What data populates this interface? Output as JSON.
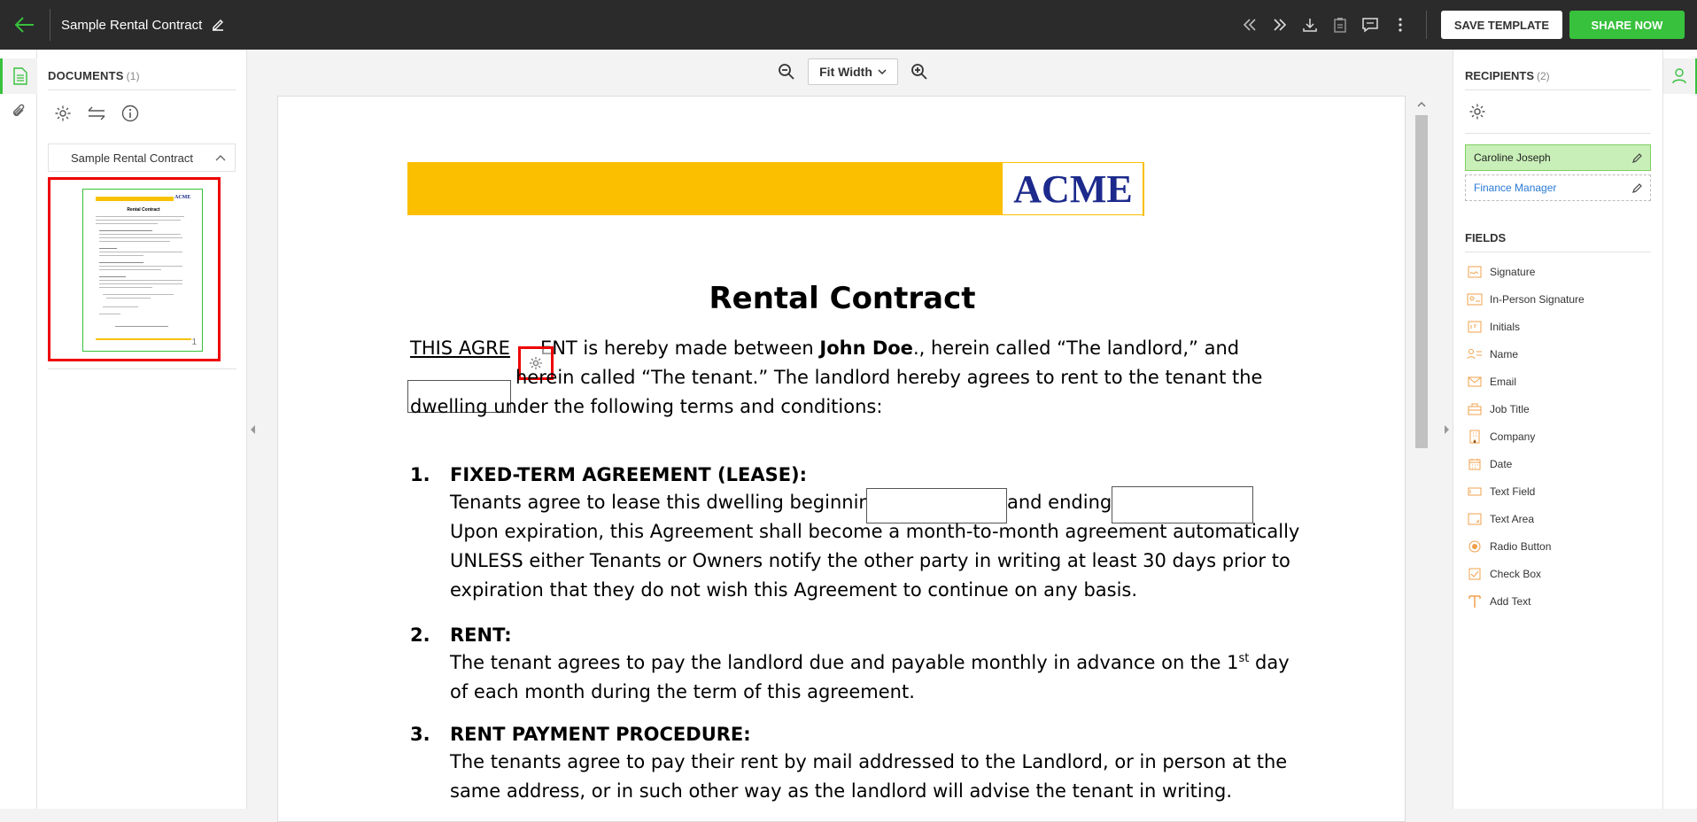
{
  "topbar": {
    "title": "Sample Rental Contract",
    "save_template_label": "SAVE TEMPLATE",
    "share_now_label": "SHARE NOW"
  },
  "documents": {
    "heading": "DOCUMENTS",
    "count": "(1)",
    "items": [
      {
        "label": "Sample Rental Contract"
      }
    ],
    "thumbnail_title": "Rental Contract",
    "thumbnail_logo": "ACME",
    "thumbnail_page": "1"
  },
  "viewer": {
    "zoom_label": "Fit Width"
  },
  "document": {
    "logo": "ACME",
    "title": "Rental Contract",
    "intro_line1_a": "THIS AGRE",
    "intro_line1_b": "ENT is hereby made between ",
    "intro_party": "John Doe",
    "intro_line1_c": "., herein called “The landlord,” and",
    "intro_line2": "herein called “The tenant.”  The landlord hereby agrees to rent to the tenant the",
    "intro_line3": "dwelling under the following terms and conditions:",
    "sections": [
      {
        "num": "1.",
        "title": "FIXED-TERM AGREEMENT (LEASE):",
        "line1_a": "Tenants agree to lease this dwelling beginning",
        "line1_b": "and ending",
        "line2": "Upon expiration, this Agreement shall become a month-to-month agreement automatically",
        "line3": "UNLESS either Tenants or Owners notify the other party in writing at least 30 days prior to",
        "line4": "expiration that they do not wish this Agreement to continue on any basis."
      },
      {
        "num": "2.",
        "title": "RENT:",
        "line1_a": "The tenant agrees to pay the landlord due and payable monthly in advance on the 1",
        "line1_sup": "st",
        "line1_b": " day",
        "line2": "of each month during the term of this agreement."
      },
      {
        "num": "3.",
        "title": "RENT PAYMENT PROCEDURE:",
        "line1": "The tenants agree to pay their rent by mail addressed to the Landlord, or in person at the",
        "line2": "same address, or in such other way as the landlord will advise the tenant in writing."
      }
    ]
  },
  "recipients": {
    "heading": "RECIPIENTS",
    "count": "(2)",
    "items": [
      {
        "name": "Caroline Joseph"
      },
      {
        "name": "Finance Manager"
      }
    ]
  },
  "fields": {
    "heading": "FIELDS",
    "items": [
      {
        "label": "Signature",
        "icon": "signature-icon"
      },
      {
        "label": "In-Person Signature",
        "icon": "in-person-signature-icon"
      },
      {
        "label": "Initials",
        "icon": "initials-icon"
      },
      {
        "label": "Name",
        "icon": "name-icon"
      },
      {
        "label": "Email",
        "icon": "email-icon"
      },
      {
        "label": "Job Title",
        "icon": "job-title-icon"
      },
      {
        "label": "Company",
        "icon": "company-icon"
      },
      {
        "label": "Date",
        "icon": "calendar-icon"
      },
      {
        "label": "Text Field",
        "icon": "text-field-icon"
      },
      {
        "label": "Text Area",
        "icon": "text-area-icon"
      },
      {
        "label": "Radio Button",
        "icon": "radio-button-icon"
      },
      {
        "label": "Check Box",
        "icon": "check-box-icon"
      },
      {
        "label": "Add Text",
        "icon": "add-text-icon"
      }
    ]
  },
  "colors": {
    "accent_green": "#38c13d",
    "field_icon_orange": "#f0a04b",
    "header_gold": "#fbbf00",
    "logo_blue": "#1c2a8c",
    "highlight_red": "#ee0000"
  }
}
